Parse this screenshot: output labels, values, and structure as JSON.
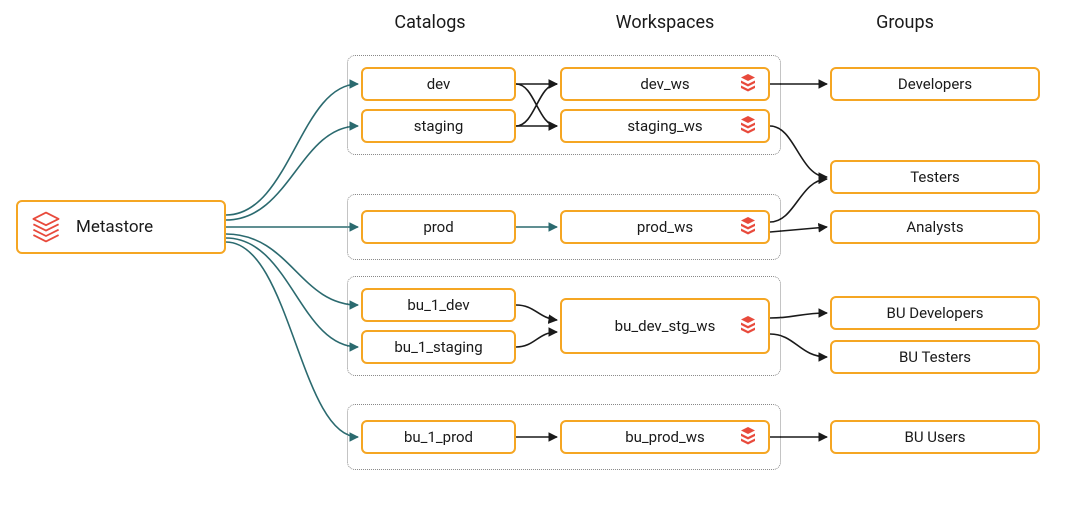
{
  "headers": {
    "catalogs": "Catalogs",
    "workspaces": "Workspaces",
    "groups": "Groups"
  },
  "metastore": {
    "label": "Metastore"
  },
  "catalogs": {
    "dev": "dev",
    "staging": "staging",
    "prod": "prod",
    "bu1dev": "bu_1_dev",
    "bu1staging": "bu_1_staging",
    "bu1prod": "bu_1_prod"
  },
  "workspaces": {
    "devws": "dev_ws",
    "stagingws": "staging_ws",
    "prodws": "prod_ws",
    "budevstgws": "bu_dev_stg_ws",
    "buprodws": "bu_prod_ws"
  },
  "groups": {
    "developers": "Developers",
    "testers": "Testers",
    "analysts": "Analysts",
    "budevelopers": "BU Developers",
    "butesters": "BU Testers",
    "buusers": "BU Users"
  },
  "colors": {
    "nodeBorder": "#f5a623",
    "iconRed": "#e84a3c",
    "lineTeal": "#2b6a6f",
    "lineBlack": "#1a1a1a",
    "groupBorder": "#888888"
  }
}
